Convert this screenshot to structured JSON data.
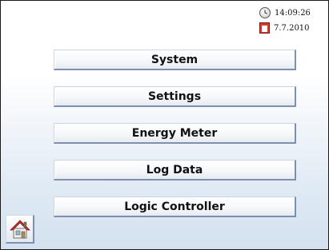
{
  "status": {
    "time": "14:09:26",
    "date": "7.7.2010"
  },
  "menu": {
    "items": [
      {
        "label": "System"
      },
      {
        "label": "Settings"
      },
      {
        "label": "Energy Meter"
      },
      {
        "label": "Log Data"
      },
      {
        "label": "Logic Controller"
      }
    ]
  },
  "icons": {
    "clock": "clock-icon",
    "calendar": "calendar-icon",
    "home": "home-icon"
  },
  "colors": {
    "button_border_dark": "#7f8fb0",
    "roof_red": "#c8332a"
  }
}
